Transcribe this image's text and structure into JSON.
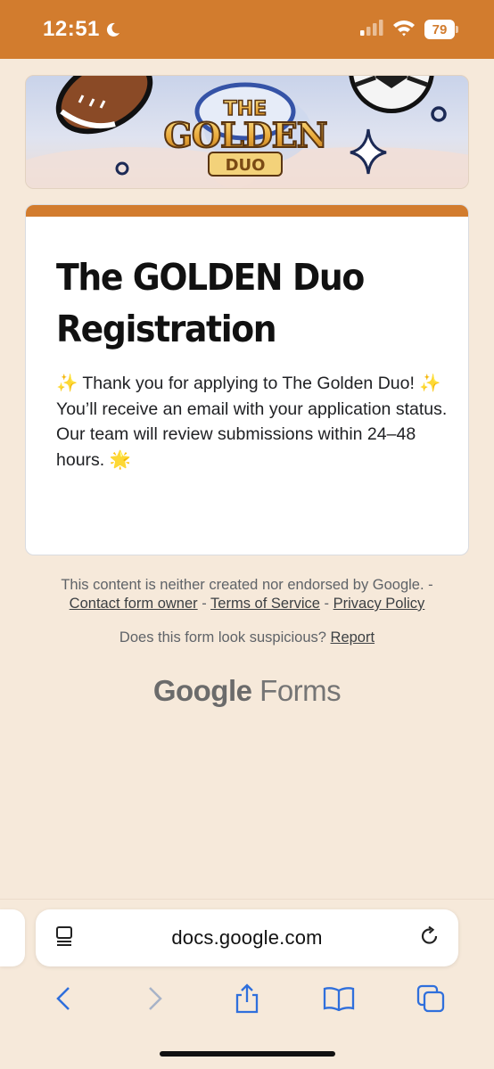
{
  "status_bar": {
    "time": "12:51",
    "battery": "79",
    "icons": [
      "moon-icon",
      "signal-icon",
      "wifi-icon",
      "battery-icon"
    ]
  },
  "banner": {
    "logo_line1": "THE",
    "logo_line2": "GOLDEN",
    "logo_line3": "DUO"
  },
  "form": {
    "title": "The GOLDEN Duo Registration",
    "description_lines": [
      "✨ Thank you for applying to The Golden Duo! ✨",
      "You’ll receive an email with your application status.",
      "Our team will review submissions within 24–48 hours. 🌟"
    ]
  },
  "footer": {
    "disclaimer": "This content is neither created nor endorsed by Google. -",
    "contact_link": "Contact form owner",
    "terms_link": "Terms of Service",
    "privacy_link": "Privacy Policy",
    "separator": "-",
    "suspicious_text": "Does this form look suspicious?",
    "report_link": "Report",
    "brand_google": "Google",
    "brand_forms": "Forms"
  },
  "browser": {
    "url": "docs.google.com",
    "icons": [
      "reader-icon",
      "reload-icon",
      "back-icon",
      "forward-icon",
      "share-icon",
      "bookmarks-icon",
      "tabs-icon"
    ]
  },
  "colors": {
    "accent": "#d27c2e",
    "background": "#f6e9da"
  }
}
